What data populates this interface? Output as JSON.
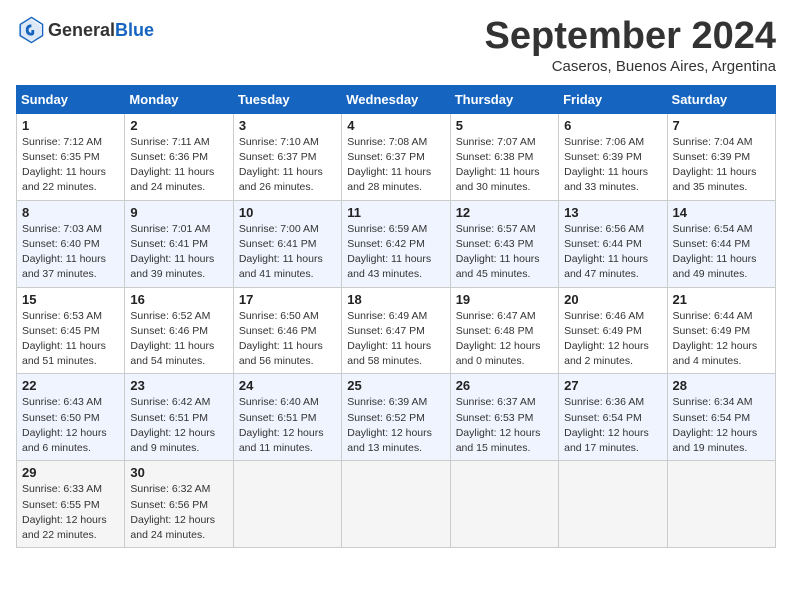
{
  "header": {
    "logo_general": "General",
    "logo_blue": "Blue",
    "month_title": "September 2024",
    "location": "Caseros, Buenos Aires, Argentina"
  },
  "days_of_week": [
    "Sunday",
    "Monday",
    "Tuesday",
    "Wednesday",
    "Thursday",
    "Friday",
    "Saturday"
  ],
  "weeks": [
    [
      {
        "day": "1",
        "info": "Sunrise: 7:12 AM\nSunset: 6:35 PM\nDaylight: 11 hours\nand 22 minutes."
      },
      {
        "day": "2",
        "info": "Sunrise: 7:11 AM\nSunset: 6:36 PM\nDaylight: 11 hours\nand 24 minutes."
      },
      {
        "day": "3",
        "info": "Sunrise: 7:10 AM\nSunset: 6:37 PM\nDaylight: 11 hours\nand 26 minutes."
      },
      {
        "day": "4",
        "info": "Sunrise: 7:08 AM\nSunset: 6:37 PM\nDaylight: 11 hours\nand 28 minutes."
      },
      {
        "day": "5",
        "info": "Sunrise: 7:07 AM\nSunset: 6:38 PM\nDaylight: 11 hours\nand 30 minutes."
      },
      {
        "day": "6",
        "info": "Sunrise: 7:06 AM\nSunset: 6:39 PM\nDaylight: 11 hours\nand 33 minutes."
      },
      {
        "day": "7",
        "info": "Sunrise: 7:04 AM\nSunset: 6:39 PM\nDaylight: 11 hours\nand 35 minutes."
      }
    ],
    [
      {
        "day": "8",
        "info": "Sunrise: 7:03 AM\nSunset: 6:40 PM\nDaylight: 11 hours\nand 37 minutes."
      },
      {
        "day": "9",
        "info": "Sunrise: 7:01 AM\nSunset: 6:41 PM\nDaylight: 11 hours\nand 39 minutes."
      },
      {
        "day": "10",
        "info": "Sunrise: 7:00 AM\nSunset: 6:41 PM\nDaylight: 11 hours\nand 41 minutes."
      },
      {
        "day": "11",
        "info": "Sunrise: 6:59 AM\nSunset: 6:42 PM\nDaylight: 11 hours\nand 43 minutes."
      },
      {
        "day": "12",
        "info": "Sunrise: 6:57 AM\nSunset: 6:43 PM\nDaylight: 11 hours\nand 45 minutes."
      },
      {
        "day": "13",
        "info": "Sunrise: 6:56 AM\nSunset: 6:44 PM\nDaylight: 11 hours\nand 47 minutes."
      },
      {
        "day": "14",
        "info": "Sunrise: 6:54 AM\nSunset: 6:44 PM\nDaylight: 11 hours\nand 49 minutes."
      }
    ],
    [
      {
        "day": "15",
        "info": "Sunrise: 6:53 AM\nSunset: 6:45 PM\nDaylight: 11 hours\nand 51 minutes."
      },
      {
        "day": "16",
        "info": "Sunrise: 6:52 AM\nSunset: 6:46 PM\nDaylight: 11 hours\nand 54 minutes."
      },
      {
        "day": "17",
        "info": "Sunrise: 6:50 AM\nSunset: 6:46 PM\nDaylight: 11 hours\nand 56 minutes."
      },
      {
        "day": "18",
        "info": "Sunrise: 6:49 AM\nSunset: 6:47 PM\nDaylight: 11 hours\nand 58 minutes."
      },
      {
        "day": "19",
        "info": "Sunrise: 6:47 AM\nSunset: 6:48 PM\nDaylight: 12 hours\nand 0 minutes."
      },
      {
        "day": "20",
        "info": "Sunrise: 6:46 AM\nSunset: 6:49 PM\nDaylight: 12 hours\nand 2 minutes."
      },
      {
        "day": "21",
        "info": "Sunrise: 6:44 AM\nSunset: 6:49 PM\nDaylight: 12 hours\nand 4 minutes."
      }
    ],
    [
      {
        "day": "22",
        "info": "Sunrise: 6:43 AM\nSunset: 6:50 PM\nDaylight: 12 hours\nand 6 minutes."
      },
      {
        "day": "23",
        "info": "Sunrise: 6:42 AM\nSunset: 6:51 PM\nDaylight: 12 hours\nand 9 minutes."
      },
      {
        "day": "24",
        "info": "Sunrise: 6:40 AM\nSunset: 6:51 PM\nDaylight: 12 hours\nand 11 minutes."
      },
      {
        "day": "25",
        "info": "Sunrise: 6:39 AM\nSunset: 6:52 PM\nDaylight: 12 hours\nand 13 minutes."
      },
      {
        "day": "26",
        "info": "Sunrise: 6:37 AM\nSunset: 6:53 PM\nDaylight: 12 hours\nand 15 minutes."
      },
      {
        "day": "27",
        "info": "Sunrise: 6:36 AM\nSunset: 6:54 PM\nDaylight: 12 hours\nand 17 minutes."
      },
      {
        "day": "28",
        "info": "Sunrise: 6:34 AM\nSunset: 6:54 PM\nDaylight: 12 hours\nand 19 minutes."
      }
    ],
    [
      {
        "day": "29",
        "info": "Sunrise: 6:33 AM\nSunset: 6:55 PM\nDaylight: 12 hours\nand 22 minutes."
      },
      {
        "day": "30",
        "info": "Sunrise: 6:32 AM\nSunset: 6:56 PM\nDaylight: 12 hours\nand 24 minutes."
      },
      {
        "day": "",
        "info": ""
      },
      {
        "day": "",
        "info": ""
      },
      {
        "day": "",
        "info": ""
      },
      {
        "day": "",
        "info": ""
      },
      {
        "day": "",
        "info": ""
      }
    ]
  ]
}
